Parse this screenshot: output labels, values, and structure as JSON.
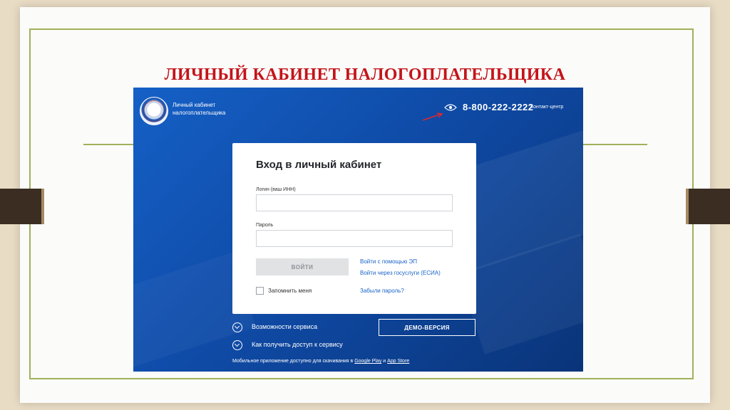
{
  "slide": {
    "title": "ЛИЧНЫЙ КАБИНЕТ НАЛОГОПЛАТЕЛЬЩИКА"
  },
  "header": {
    "brand_line1": "Личный кабинет",
    "brand_line2": "налогоплательщика",
    "phone": "8-800-222-2222",
    "contact": "Контакт-центр"
  },
  "login": {
    "heading": "Вход в личный кабинет",
    "login_label": "Логин (ваш ИНН)",
    "login_value": "",
    "password_label": "Пароль",
    "password_value": "",
    "submit_label": "ВОЙТИ",
    "ep_link": "Войти с помощью ЭП",
    "esia_link": "Войти через госуслуги (ЕСИА)",
    "remember_label": "Запомнить меня",
    "forgot_link": "Забыли пароль?"
  },
  "footer": {
    "features": "Возможности сервиса",
    "access": "Как получить доступ к сервису",
    "demo_label": "ДЕМО-ВЕРСИЯ",
    "mobile_prefix": "Мобильное приложение доступно для скачивания в",
    "google_play": "Google Play",
    "and": "и",
    "app_store": "App Store"
  },
  "icons": {
    "emblem": "fns-emblem-icon",
    "eye": "eye-icon",
    "arrow": "annotation-arrow-icon",
    "chevron": "chevron-down-icon"
  },
  "colors": {
    "title_red": "#c3141a",
    "frame_green": "#9fb15a",
    "site_blue": "#1560c6",
    "link_blue": "#1a64c8"
  }
}
